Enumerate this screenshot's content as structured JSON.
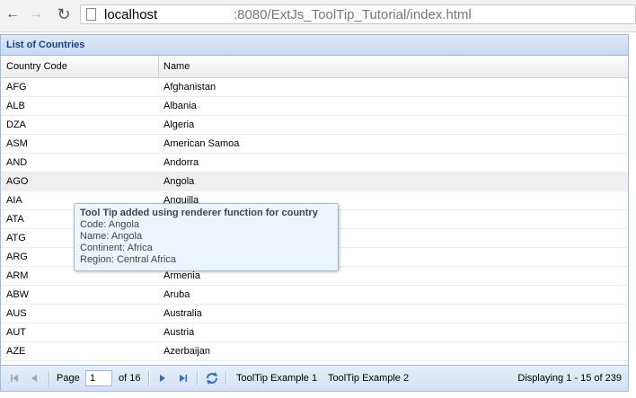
{
  "browser": {
    "url_host": "localhost",
    "url_path": ":8080/ExtJs_ToolTip_Tutorial/index.html"
  },
  "panel": {
    "title": "List of Countries"
  },
  "grid": {
    "columns": [
      "Country Code",
      "Name"
    ],
    "rows": [
      {
        "code": "AFG",
        "name": "Afghanistan"
      },
      {
        "code": "ALB",
        "name": "Albania"
      },
      {
        "code": "DZA",
        "name": "Algeria"
      },
      {
        "code": "ASM",
        "name": "American Samoa"
      },
      {
        "code": "AND",
        "name": "Andorra"
      },
      {
        "code": "AGO",
        "name": "Angola"
      },
      {
        "code": "AIA",
        "name": "Anguilla"
      },
      {
        "code": "ATA",
        "name": ""
      },
      {
        "code": "ATG",
        "name": ""
      },
      {
        "code": "ARG",
        "name": ""
      },
      {
        "code": "ARM",
        "name": "Armenia"
      },
      {
        "code": "ABW",
        "name": "Aruba"
      },
      {
        "code": "AUS",
        "name": "Australia"
      },
      {
        "code": "AUT",
        "name": "Austria"
      },
      {
        "code": "AZE",
        "name": "Azerbaijan"
      }
    ],
    "hover_row": 5
  },
  "tooltip": {
    "title": "Tool Tip added using renderer function for country",
    "lines": [
      "Code: Angola",
      "Name: Angola",
      "Continent: Africa",
      "Region: Central Africa"
    ]
  },
  "pager": {
    "page_label": "Page",
    "page_value": "1",
    "of_label": "of 16",
    "button1": "ToolTip Example 1",
    "button2": "ToolTip Example 2",
    "display": "Displaying 1 - 15 of 239"
  },
  "colors": {
    "accent": "#15428b",
    "border": "#99bbe8",
    "blue_icon": "#2f6fc5"
  }
}
